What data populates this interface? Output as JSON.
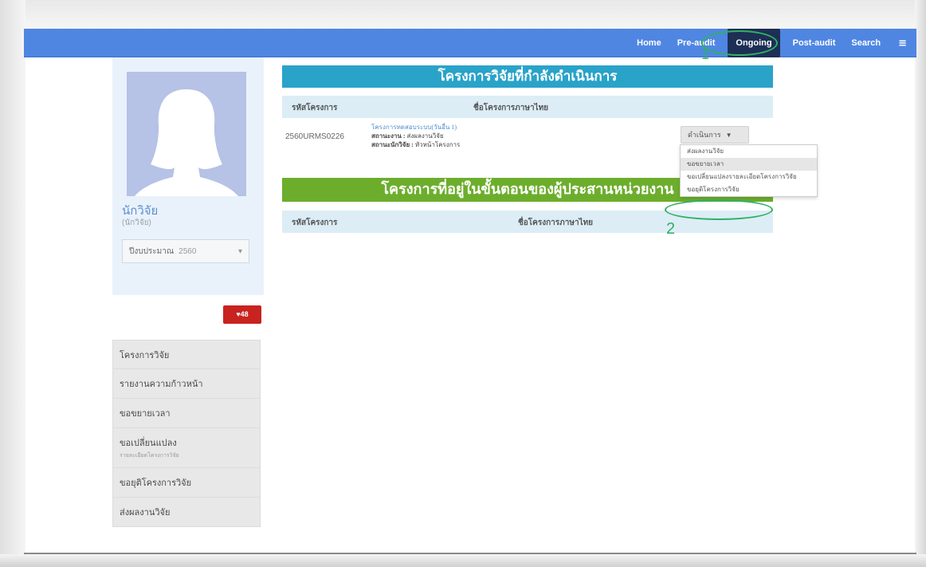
{
  "navbar": {
    "items": [
      {
        "label": "Home"
      },
      {
        "label": "Pre-audit"
      },
      {
        "label": "Ongoing"
      },
      {
        "label": "Post-audit"
      },
      {
        "label": "Search"
      }
    ],
    "menu_icon": "hamburger-icon",
    "active": "Ongoing",
    "color": "#4f86e2"
  },
  "annotations": {
    "marker1": "1",
    "marker2": "2",
    "color": "#2fb063"
  },
  "profile": {
    "name": "นักวิจัย",
    "role": "(นักวิจัย)",
    "year_label": "ปีงบประมาณ",
    "year_value": "2560"
  },
  "notification": {
    "label": "♥48"
  },
  "sidebar_menu": [
    {
      "label": "โครงการวิจัย"
    },
    {
      "label": "รายงานความก้าวหน้า"
    },
    {
      "label": "ขอขยายเวลา"
    },
    {
      "label": "ขอเปลี่ยนแปลง",
      "sub": "รายละเอียดโครงการวิจัย"
    },
    {
      "label": "ขอยุติโครงการวิจัย"
    },
    {
      "label": "ส่งผลงานวิจัย"
    }
  ],
  "ongoing_panel": {
    "title": "โครงการวิจัยที่กำลังดำเนินการ",
    "col_code": "รหัสโครงการ",
    "col_name": "ชื่อโครงการภาษาไทย",
    "rows": [
      {
        "code": "2560URMS0226",
        "title": "โครงการทดสอบระบบ(วันอื่น 1)",
        "status_label": "สถานะงาน :",
        "status_value": "ส่งผลงานวิจัย",
        "researcher_status_label": "สถานะนักวิจัย :",
        "researcher_status_value": "หัวหน้าโครงการ"
      }
    ]
  },
  "manage_button": {
    "label": "ดำเนินการ"
  },
  "dropdown": {
    "items": [
      {
        "label": "ส่งผลงานวิจัย"
      },
      {
        "label": "ขอขยายเวลา"
      },
      {
        "label": "ขอเปลี่ยนแปลงรายละเอียดโครงการวิจัย"
      },
      {
        "label": "ขอยุติโครงการวิจัย"
      }
    ]
  },
  "coordinator_panel": {
    "title": "โครงการที่อยู่ในขั้นตอนของผู้ประสานหน่วยงาน",
    "col_code": "รหัสโครงการ",
    "col_name": "ชื่อโครงการภาษาไทย"
  }
}
